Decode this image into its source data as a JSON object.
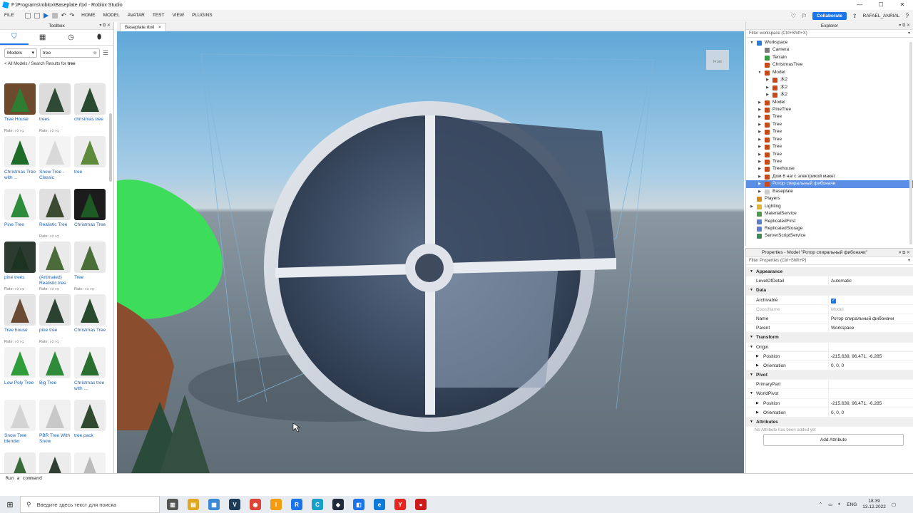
{
  "window": {
    "title": "F:\\Programs\\roblox\\Baseplate.rbxl - Roblox Studio",
    "controls": [
      "—",
      "☐",
      "✕"
    ]
  },
  "menu": {
    "file": "FILE",
    "items": [
      "HOME",
      "MODEL",
      "AVATAR",
      "TEST",
      "VIEW",
      "PLUGINS"
    ],
    "collaborate": "Collaborate",
    "user": "RAFAEL_ANRIAL"
  },
  "toolbox": {
    "title": "Toolbox",
    "category": "Models",
    "search_value": "tree",
    "breadcrumb_prefix": "< All Models / Search Results for",
    "breadcrumb_term": "tree",
    "rate_label": "Rate:",
    "items": [
      {
        "label": "Tree House",
        "rate": true,
        "bg": "#6d4a2e",
        "leaf": "#2f7d32"
      },
      {
        "label": "trees",
        "rate": true,
        "bg": "#dcdcdc",
        "leaf": "#2e4a35"
      },
      {
        "label": "christmas tree",
        "rate": false,
        "bg": "#e6e6e6",
        "leaf": "#294a30"
      },
      {
        "label": "Christmas Tree with ...",
        "rate": false,
        "bg": "#f0f0f0",
        "leaf": "#1f6b2a"
      },
      {
        "label": "Snow Tree - Classic",
        "rate": false,
        "bg": "#f4f4f4",
        "leaf": "#d9d9d9"
      },
      {
        "label": "tree",
        "rate": false,
        "bg": "#ececec",
        "leaf": "#5e8a3c"
      },
      {
        "label": "Pine Tree",
        "rate": false,
        "bg": "#f0f0f0",
        "leaf": "#2e8b3c"
      },
      {
        "label": "Realistic Tree",
        "rate": true,
        "bg": "#e0e0e0",
        "leaf": "#3b4a30"
      },
      {
        "label": "Christmas Tree",
        "rate": false,
        "bg": "#1c1c1c",
        "leaf": "#1e5a23"
      },
      {
        "label": "pine trees",
        "rate": true,
        "bg": "#2c3a30",
        "leaf": "#1d3322"
      },
      {
        "label": "(Animated) Realistic tree",
        "rate": true,
        "bg": "#eaeaea",
        "leaf": "#4b6b3a"
      },
      {
        "label": "Tree",
        "rate": true,
        "bg": "#e8e8e8",
        "leaf": "#4a6e38"
      },
      {
        "label": "Tree house",
        "rate": true,
        "bg": "#e4e4e4",
        "leaf": "#6b4b34"
      },
      {
        "label": "pine tree",
        "rate": true,
        "bg": "#e4e4e4",
        "leaf": "#2c4230"
      },
      {
        "label": "Christmas Tree",
        "rate": false,
        "bg": "#ececec",
        "leaf": "#2a4a2e"
      },
      {
        "label": "Low Poly Tree",
        "rate": false,
        "bg": "#f2f2f2",
        "leaf": "#2e9d3a"
      },
      {
        "label": "Big Tree",
        "rate": false,
        "bg": "#eeeeee",
        "leaf": "#2f8a3a"
      },
      {
        "label": "Christmas tree with ...",
        "rate": false,
        "bg": "#f0f0f0",
        "leaf": "#2a6e32"
      },
      {
        "label": "Snow Tree blender",
        "rate": false,
        "bg": "#f2f2f2",
        "leaf": "#d4d4d4"
      },
      {
        "label": "PBR Tree With Snow",
        "rate": false,
        "bg": "#f0f0f0",
        "leaf": "#c8c8c8"
      },
      {
        "label": "tree pack",
        "rate": false,
        "bg": "#ececec",
        "leaf": "#2f4a2f"
      },
      {
        "label": "",
        "rate": false,
        "bg": "#ececec",
        "leaf": "#3a6a3a"
      },
      {
        "label": "",
        "rate": false,
        "bg": "#ececec",
        "leaf": "#2f3f33"
      },
      {
        "label": "",
        "rate": false,
        "bg": "#f2f2f2",
        "leaf": "#bbbbbb"
      }
    ]
  },
  "tabs": {
    "doc": "Baseplate.rbxl",
    "close": "×"
  },
  "viewport": {
    "view_cube_label": "Front"
  },
  "explorer": {
    "title": "Explorer",
    "filter_placeholder": "Filter workspace (Ctrl+Shift+X)",
    "rows": [
      {
        "label": "Workspace",
        "level": 0,
        "arrow": "▼",
        "icon": "#2b7bd6",
        "selected": false
      },
      {
        "label": "Camera",
        "level": 1,
        "arrow": "",
        "icon": "#7a7a7a",
        "selected": false
      },
      {
        "label": "Terrain",
        "level": 1,
        "arrow": "",
        "icon": "#3c9a45",
        "selected": false
      },
      {
        "label": "ChristmasTree",
        "level": 1,
        "arrow": "",
        "icon": "#c84a1a",
        "selected": false
      },
      {
        "label": "Model",
        "level": 1,
        "arrow": "▼",
        "icon": "#c84a1a",
        "selected": false
      },
      {
        "label": "木2",
        "level": 2,
        "arrow": "▶",
        "icon": "#c84a1a",
        "selected": false
      },
      {
        "label": "木2",
        "level": 2,
        "arrow": "▶",
        "icon": "#c84a1a",
        "selected": false
      },
      {
        "label": "木2",
        "level": 2,
        "arrow": "▶",
        "icon": "#c84a1a",
        "selected": false
      },
      {
        "label": "Model",
        "level": 1,
        "arrow": "▶",
        "icon": "#c84a1a",
        "selected": false
      },
      {
        "label": "PineTree",
        "level": 1,
        "arrow": "▶",
        "icon": "#c84a1a",
        "selected": false
      },
      {
        "label": "Tree",
        "level": 1,
        "arrow": "▶",
        "icon": "#c84a1a",
        "selected": false
      },
      {
        "label": "Tree",
        "level": 1,
        "arrow": "▶",
        "icon": "#c84a1a",
        "selected": false
      },
      {
        "label": "Tree",
        "level": 1,
        "arrow": "▶",
        "icon": "#c84a1a",
        "selected": false
      },
      {
        "label": "Tree",
        "level": 1,
        "arrow": "▶",
        "icon": "#c84a1a",
        "selected": false
      },
      {
        "label": "Tree",
        "level": 1,
        "arrow": "▶",
        "icon": "#c84a1a",
        "selected": false
      },
      {
        "label": "Tree",
        "level": 1,
        "arrow": "▶",
        "icon": "#c84a1a",
        "selected": false
      },
      {
        "label": "Tree",
        "level": 1,
        "arrow": "▶",
        "icon": "#c84a1a",
        "selected": false
      },
      {
        "label": "Treehouse",
        "level": 1,
        "arrow": "▶",
        "icon": "#c84a1a",
        "selected": false
      },
      {
        "label": "Дом 6 наi с электрикой макет",
        "level": 1,
        "arrow": "▶",
        "icon": "#c84a1a",
        "selected": false
      },
      {
        "label": "Ротор спиральный фибоначи",
        "level": 1,
        "arrow": "▶",
        "icon": "#c84a1a",
        "selected": true
      },
      {
        "label": "Baseplate",
        "level": 1,
        "arrow": "▶",
        "icon": "#cccccc",
        "selected": false
      },
      {
        "label": "Players",
        "level": 0,
        "arrow": "",
        "icon": "#d48a1a",
        "selected": false
      },
      {
        "label": "Lighting",
        "level": 0,
        "arrow": "▶",
        "icon": "#e2b32a",
        "selected": false
      },
      {
        "label": "MaterialService",
        "level": 0,
        "arrow": "",
        "icon": "#4b9a4b",
        "selected": false
      },
      {
        "label": "ReplicatedFirst",
        "level": 0,
        "arrow": "",
        "icon": "#5a7ec9",
        "selected": false
      },
      {
        "label": "ReplicatedStorage",
        "level": 0,
        "arrow": "",
        "icon": "#5a7ec9",
        "selected": false
      },
      {
        "label": "ServerScriptService",
        "level": 0,
        "arrow": "",
        "icon": "#3b8a5a",
        "selected": false
      }
    ]
  },
  "properties": {
    "title": "Properties - Model \"Ротор спиральный фибоначи\"",
    "filter_placeholder": "Filter Properties (Ctrl+Shift+P)",
    "rows": [
      {
        "type": "cat",
        "name": "Appearance",
        "value": ""
      },
      {
        "type": "prop",
        "name": "LevelOfDetail",
        "value": "Automatic"
      },
      {
        "type": "cat",
        "name": "Data",
        "value": ""
      },
      {
        "type": "check",
        "name": "Archivable",
        "value": "✓"
      },
      {
        "type": "dim",
        "name": "ClassName",
        "value": "Model"
      },
      {
        "type": "prop",
        "name": "Name",
        "value": "Ротор спиральный фибоначи"
      },
      {
        "type": "prop",
        "name": "Parent",
        "value": "Workspace"
      },
      {
        "type": "cat",
        "name": "Transform",
        "value": ""
      },
      {
        "type": "group",
        "name": "Origin",
        "value": ""
      },
      {
        "type": "sub",
        "name": "Position",
        "value": "-215.639, 96.471, -6.285"
      },
      {
        "type": "sub",
        "name": "Orientation",
        "value": "0, 0, 0"
      },
      {
        "type": "cat",
        "name": "Pivot",
        "value": ""
      },
      {
        "type": "prop",
        "name": "PrimaryPart",
        "value": ""
      },
      {
        "type": "group",
        "name": "WorldPivot",
        "value": ""
      },
      {
        "type": "sub",
        "name": "Position",
        "value": "-215.639, 96.471, -6.285"
      },
      {
        "type": "sub",
        "name": "Orientation",
        "value": "0, 0, 0"
      },
      {
        "type": "cat",
        "name": "Attributes",
        "value": ""
      }
    ],
    "no_attributes": "No Attribute has been added yet",
    "add_attribute": "Add Attribute"
  },
  "command": {
    "placeholder": "Run a command"
  },
  "taskbar": {
    "search_placeholder": "Введите здесь текст для поиска",
    "apps": [
      {
        "glyph": "▥",
        "color": "#555555"
      },
      {
        "glyph": "▤",
        "color": "#e0a81e"
      },
      {
        "glyph": "▦",
        "color": "#3a8ad6"
      },
      {
        "glyph": "V",
        "color": "#1c3b57"
      },
      {
        "glyph": "◉",
        "color": "#db4437"
      },
      {
        "glyph": "I",
        "color": "#f39c12"
      },
      {
        "glyph": "R",
        "color": "#1a73e8"
      },
      {
        "glyph": "C",
        "color": "#19a0c9"
      },
      {
        "glyph": "◆",
        "color": "#1f2b3a"
      },
      {
        "glyph": "◧",
        "color": "#1a73e8"
      },
      {
        "glyph": "e",
        "color": "#0f7bd8"
      },
      {
        "glyph": "Y",
        "color": "#e52620"
      },
      {
        "glyph": "●",
        "color": "#cc1b1b"
      }
    ],
    "lang": "ENG",
    "time": "18:39",
    "date": "13.12.2022"
  }
}
